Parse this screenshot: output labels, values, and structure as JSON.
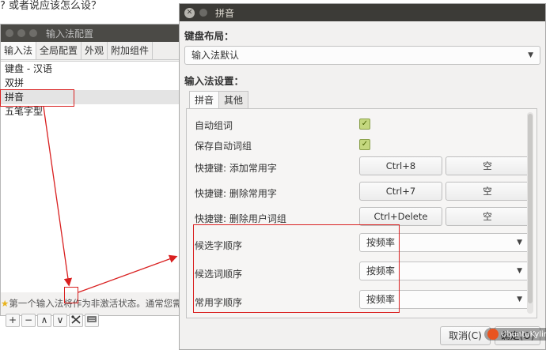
{
  "background_text": "? 或者说应该怎么设？",
  "config_window": {
    "title": "输入法配置",
    "tabs": [
      "输入法",
      "全局配置",
      "外观",
      "附加组件"
    ],
    "im_list": [
      "键盘 - 汉语",
      "双拼",
      "拼音",
      "五笔字型"
    ],
    "selected_index": 2,
    "status_text": "第一个输入法将作为非激活状态。通常您需要",
    "toolbar": [
      "+",
      "−",
      "∧",
      "∨"
    ]
  },
  "pinyin_window": {
    "title": "拼音",
    "keyboard_layout_label": "键盘布局：",
    "keyboard_layout_value": "输入法默认",
    "im_settings_label": "输入法设置：",
    "tabs": [
      "拼音",
      "其他"
    ],
    "rows": {
      "auto_phrase": "自动组词",
      "save_auto_phrase": "保存自动词组",
      "hotkey_add": "快捷键: 添加常用字",
      "hotkey_add_value": "Ctrl+8",
      "hotkey_delete": "快捷键: 删除常用字",
      "hotkey_delete_value": "Ctrl+7",
      "hotkey_delete_user": "快捷键: 删除用户词组",
      "hotkey_delete_user_value": "Ctrl+Delete",
      "empty_label": "空",
      "candidate_order": "候选字顺序",
      "candidate_order_value": "按频率",
      "phrase_order": "候选词顺序",
      "phrase_order_value": "按频率",
      "common_order": "常用字顺序",
      "common_order_value": "按频率"
    },
    "cancel_button": "取消(C)",
    "ok_button": "确定(O)"
  },
  "logo_text": "UbuntuKylin",
  "accent_red": "#d92020"
}
